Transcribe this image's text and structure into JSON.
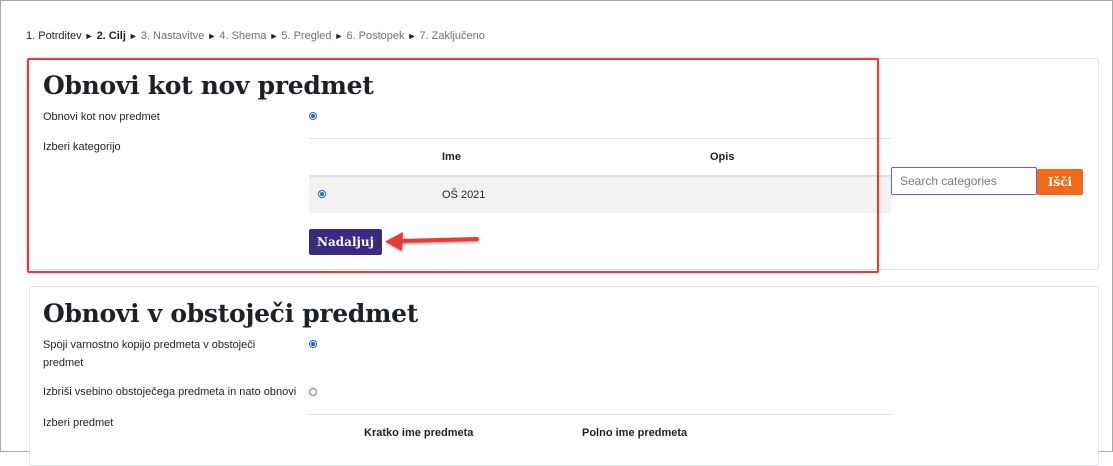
{
  "breadcrumb": {
    "steps": [
      "1. Potrditev",
      "2. Cilj",
      "3. Nastavitve",
      "4. Shema",
      "5. Pregled",
      "6. Postopek",
      "7. Zaključeno"
    ],
    "separator": "►"
  },
  "restore_new": {
    "title": "Obnovi kot nov predmet",
    "option_label": "Obnovi kot nov predmet",
    "category_label": "Izberi kategorijo",
    "table_headers": {
      "name": "Ime",
      "description": "Opis"
    },
    "rows": [
      {
        "name": "OŠ 2021",
        "description": ""
      }
    ],
    "continue_label": "Nadaljuj",
    "search": {
      "placeholder": "Search categories",
      "button_label": "Išči"
    }
  },
  "restore_existing": {
    "title": "Obnovi v obstoječi predmet",
    "merge_label_line1": "Spoji varnostno kopijo predmeta v obstoječi",
    "merge_label_line2": "predmet",
    "delete_label": "Izbriši vsebino obstoječega predmeta in nato obnovi",
    "course_label": "Izberi predmet",
    "table_headers": {
      "short_name": "Kratko ime predmeta",
      "full_name": "Polno ime predmeta"
    }
  },
  "colors": {
    "primary": "#3a2a80",
    "search": "#f16a1b",
    "highlight": "#e53b3b"
  }
}
